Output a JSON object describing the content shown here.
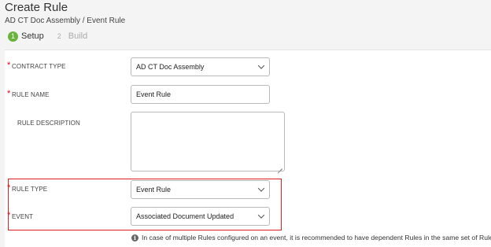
{
  "header": {
    "title": "Create Rule",
    "breadcrumb": "AD CT Doc Assembly / Event Rule"
  },
  "steps": [
    {
      "number": "1",
      "label": "Setup",
      "active": true
    },
    {
      "number": "2",
      "label": "Build",
      "active": false
    }
  ],
  "form": {
    "required_marker": "*",
    "contract_type": {
      "label": "CONTRACT TYPE",
      "value": "AD CT Doc Assembly"
    },
    "rule_name": {
      "label": "RULE NAME",
      "value": "Event Rule"
    },
    "rule_description": {
      "label": "RULE DESCRIPTION",
      "value": ""
    },
    "rule_type": {
      "label": "RULE TYPE",
      "value": "Event Rule"
    },
    "event": {
      "label": "EVENT",
      "value": "Associated Document Updated"
    }
  },
  "info": {
    "icon_glyph": "i",
    "text": "In case of multiple Rules configured on an event, it is recommended to have dependent Rules in the same set of Rules."
  },
  "colors": {
    "accent_green": "#6ab43e",
    "required_red": "#d0021b",
    "highlight_red": "#e02020"
  }
}
